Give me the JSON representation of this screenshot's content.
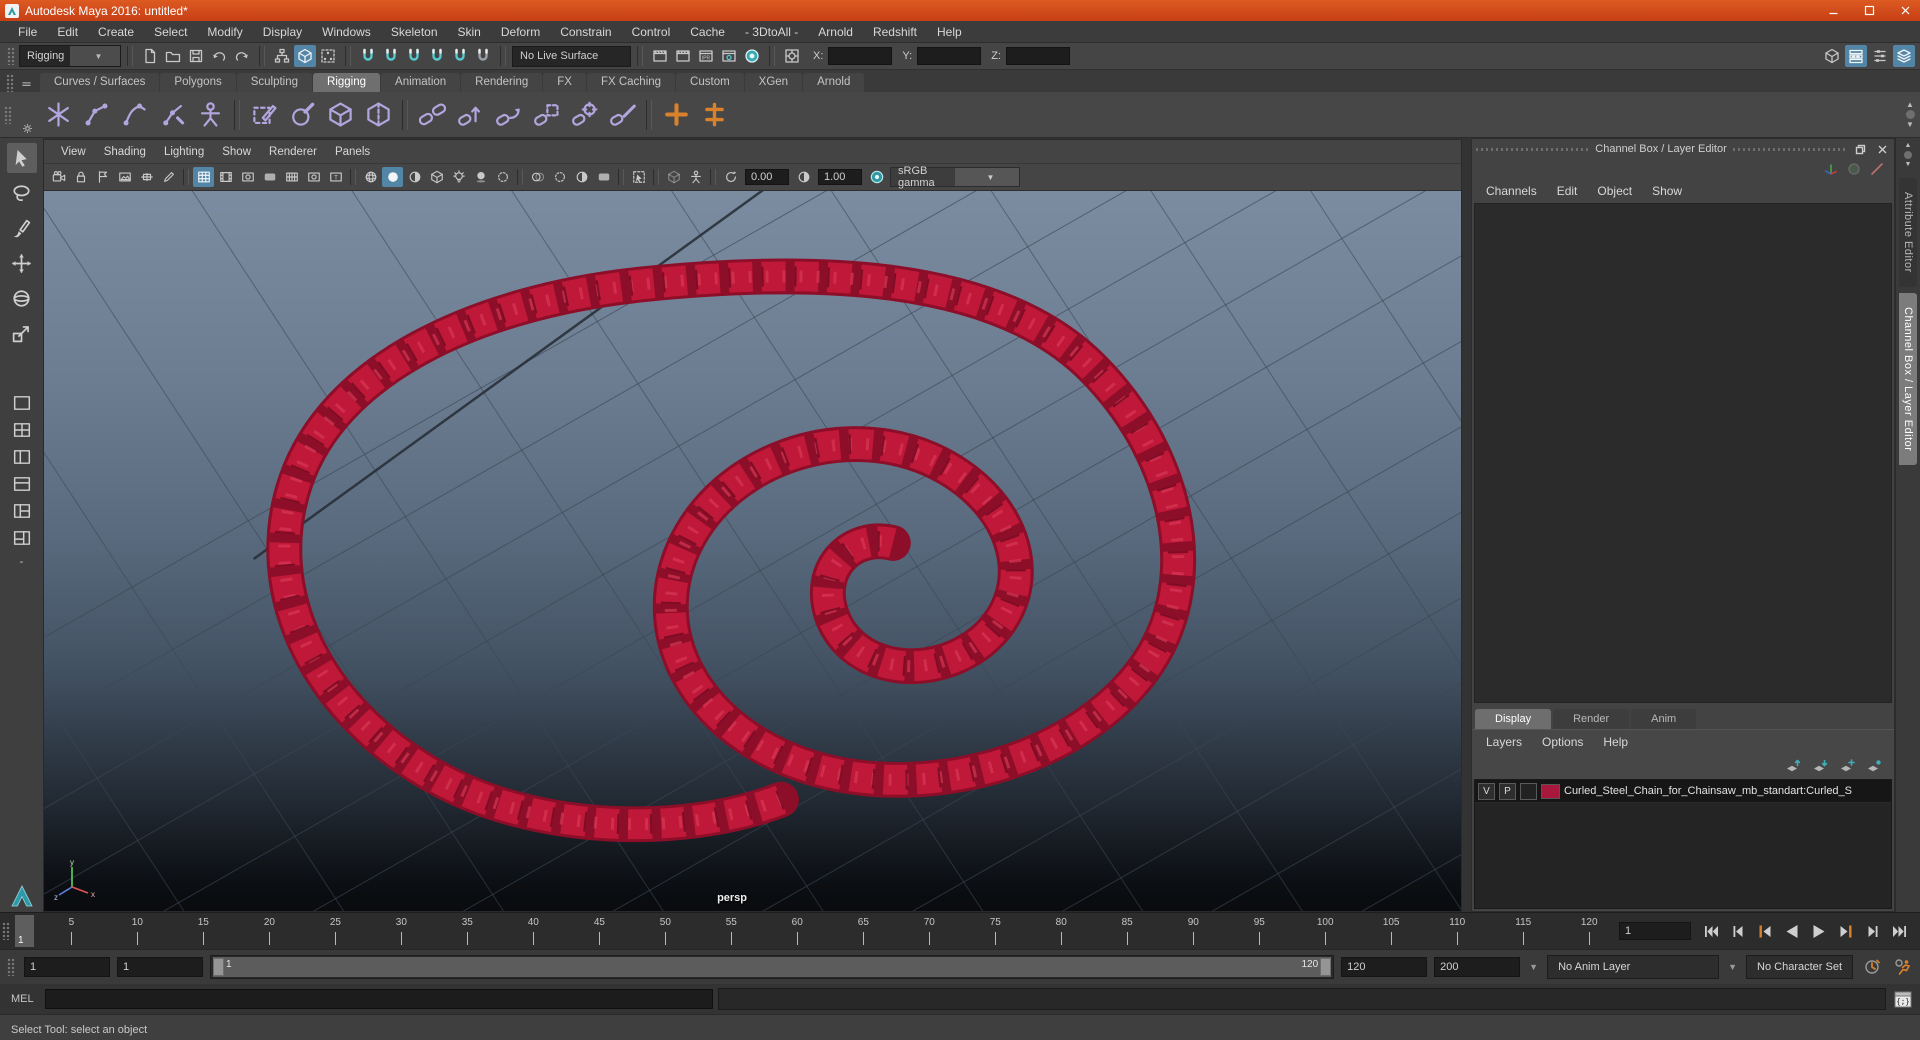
{
  "window": {
    "title": "Autodesk Maya 2016: untitled*"
  },
  "menu_bar": [
    "File",
    "Edit",
    "Create",
    "Select",
    "Modify",
    "Display",
    "Windows",
    "Skeleton",
    "Skin",
    "Deform",
    "Constrain",
    "Control",
    "Cache",
    "- 3DtoAll -",
    "Arnold",
    "Redshift",
    "Help"
  ],
  "status_line": {
    "menu_set": "Rigging",
    "live_surface": "No Live Surface",
    "xyz_labels": {
      "x": "X:",
      "y": "Y:",
      "z": "Z:"
    },
    "groups": {
      "file": [
        {
          "name": "new-scene-icon",
          "glyph": "page"
        },
        {
          "name": "open-scene-icon",
          "glyph": "folder"
        },
        {
          "name": "save-scene-icon",
          "glyph": "save"
        },
        {
          "name": "undo-icon",
          "glyph": "undo"
        },
        {
          "name": "redo-icon",
          "glyph": "redo"
        }
      ],
      "selection": [
        {
          "name": "select-by-hierarchy-icon",
          "glyph": "hier"
        },
        {
          "name": "select-by-object-icon",
          "glyph": "cube",
          "active": true
        },
        {
          "name": "select-by-component-icon",
          "glyph": "comp"
        }
      ],
      "snap": [
        {
          "name": "snap-to-grids-icon",
          "glyph": "magnet",
          "color": "#57c8d0"
        },
        {
          "name": "snap-to-curves-icon",
          "glyph": "magnet",
          "color": "#57c8d0"
        },
        {
          "name": "snap-to-points-icon",
          "glyph": "magnet",
          "color": "#57c8d0"
        },
        {
          "name": "snap-to-projected-center-icon",
          "glyph": "magnet",
          "color": "#57c8d0"
        },
        {
          "name": "snap-to-view-planes-icon",
          "glyph": "magnet",
          "color": "#57c8d0"
        },
        {
          "name": "make-live-icon",
          "glyph": "magnet",
          "color": "#9aa0a6"
        }
      ],
      "render": [
        {
          "name": "render-view-icon",
          "glyph": "slate"
        },
        {
          "name": "render-current-frame-icon",
          "glyph": "slate"
        },
        {
          "name": "ipr-render-icon",
          "glyph": "slateipr"
        },
        {
          "name": "render-settings-icon",
          "glyph": "slategear"
        },
        {
          "name": "paint-effects-icon",
          "glyph": "tealsphere"
        }
      ],
      "panel_toggles": [
        {
          "name": "show-modeling-toolkit-icon",
          "glyph": "cube"
        },
        {
          "name": "show-attribute-editor-icon",
          "glyph": "boxlist",
          "active": true
        },
        {
          "name": "show-tool-settings-icon",
          "glyph": "toolsettings"
        },
        {
          "name": "show-channel-box-icon",
          "glyph": "layers",
          "active": true
        }
      ]
    },
    "xform_icon": {
      "name": "snap-together-icon",
      "glyph": "crosshairsq"
    }
  },
  "shelf": {
    "tabs": [
      "Curves / Surfaces",
      "Polygons",
      "Sculpting",
      "Rigging",
      "Animation",
      "Rendering",
      "FX",
      "FX Caching",
      "Custom",
      "XGen",
      "Arnold"
    ],
    "active_tab": "Rigging",
    "icons": [
      {
        "name": "create-joints-icon",
        "glyph": "asterisk"
      },
      {
        "name": "ik-handle-icon",
        "glyph": "elbow"
      },
      {
        "name": "ik-spline-handle-icon",
        "glyph": "elbow2"
      },
      {
        "name": "insert-joints-icon",
        "glyph": "elbow3"
      },
      {
        "name": "quick-rig-icon",
        "glyph": "person"
      },
      {
        "sep": true
      },
      {
        "name": "edit-membership-icon",
        "glyph": "dashpencil"
      },
      {
        "name": "paint-skin-weights-icon",
        "glyph": "spherebrush"
      },
      {
        "name": "copy-skin-weights-icon",
        "glyph": "cubewire"
      },
      {
        "name": "mirror-skin-weights-icon",
        "glyph": "cubemirror"
      },
      {
        "sep": true
      },
      {
        "name": "smooth-bind-icon",
        "glyph": "link"
      },
      {
        "name": "rigid-bind-icon",
        "glyph": "linkup"
      },
      {
        "name": "detach-skin-icon",
        "glyph": "linkarrow"
      },
      {
        "name": "bind-pose-icon",
        "glyph": "linkdash"
      },
      {
        "name": "interactive-bind-icon",
        "glyph": "linktarget"
      },
      {
        "name": "unbind-skin-icon",
        "glyph": "linkslash"
      },
      {
        "sep": true
      },
      {
        "name": "parent-constraint-icon",
        "glyph": "plus",
        "color": "#d9822b"
      },
      {
        "name": "point-constraint-icon",
        "glyph": "plusline",
        "color": "#d9822b"
      }
    ]
  },
  "toolbox": {
    "tools": [
      {
        "name": "select-tool",
        "glyph": "cursor",
        "active": true
      },
      {
        "name": "lasso-tool",
        "glyph": "lasso"
      },
      {
        "name": "paint-select-tool",
        "glyph": "brush"
      },
      {
        "name": "move-tool",
        "glyph": "movetool"
      },
      {
        "name": "rotate-tool",
        "glyph": "rotatetool"
      },
      {
        "name": "scale-tool",
        "glyph": "scaletool"
      }
    ],
    "layouts": [
      {
        "name": "layout-single-pane",
        "glyph": "layout1"
      },
      {
        "name": "layout-four-pane",
        "glyph": "layout4"
      },
      {
        "name": "layout-two-side",
        "glyph": "layoutL"
      },
      {
        "name": "layout-two-stacked",
        "glyph": "layoutT"
      },
      {
        "name": "layout-outliner-persp",
        "glyph": "layoutO"
      },
      {
        "name": "layout-split-right",
        "glyph": "layoutP"
      }
    ],
    "collapse_label": "-"
  },
  "viewport": {
    "menus": [
      "View",
      "Shading",
      "Lighting",
      "Show",
      "Renderer",
      "Panels"
    ],
    "toolbar": [
      {
        "name": "select-camera-icon",
        "glyph": "camera"
      },
      {
        "name": "lock-camera-icon",
        "glyph": "lock"
      },
      {
        "name": "camera-bookmark-icon",
        "glyph": "flag"
      },
      {
        "name": "image-plane-icon",
        "glyph": "imgplane"
      },
      {
        "name": "2d-pan-zoom-icon",
        "glyph": "pan2d"
      },
      {
        "name": "grease-pencil-icon",
        "glyph": "pencil"
      },
      {
        "sep": true
      },
      {
        "name": "grid-icon",
        "glyph": "grid9",
        "active": true
      },
      {
        "name": "film-gate-icon",
        "glyph": "film"
      },
      {
        "name": "resolution-gate-icon",
        "glyph": "safeaction"
      },
      {
        "name": "gate-mask-icon",
        "glyph": "gatemask"
      },
      {
        "name": "field-chart-icon",
        "glyph": "fieldchart"
      },
      {
        "name": "safe-action-icon",
        "glyph": "safeaction"
      },
      {
        "name": "safe-title-icon",
        "glyph": "safetitle"
      },
      {
        "sep": true
      },
      {
        "name": "wireframe-icon",
        "glyph": "spherewire"
      },
      {
        "name": "smooth-shade-icon",
        "glyph": "sphereshade",
        "active": true
      },
      {
        "name": "bounding-box-icon",
        "glyph": "halfsphere"
      },
      {
        "name": "textured-icon",
        "glyph": "cubewire"
      },
      {
        "name": "use-all-lights-icon",
        "glyph": "bulb"
      },
      {
        "name": "shadows-icon",
        "glyph": "shadowball"
      },
      {
        "name": "ssao-icon",
        "glyph": "dotring"
      },
      {
        "sep": true
      },
      {
        "name": "motion-blur-icon",
        "glyph": "circles2"
      },
      {
        "name": "multisample-icon",
        "glyph": "dotring"
      },
      {
        "name": "depth-of-field-icon",
        "glyph": "contrast"
      },
      {
        "name": "fog-icon",
        "glyph": "gatemask"
      },
      {
        "sep": true
      },
      {
        "name": "isolate-select-icon",
        "glyph": "isolate"
      },
      {
        "sep": true
      },
      {
        "name": "xray-icon",
        "glyph": "xray"
      },
      {
        "name": "xray-joints-icon",
        "glyph": "person"
      }
    ],
    "exposure": "0.00",
    "gamma": "1.00",
    "view_transform": "sRGB gamma",
    "camera_label": "persp"
  },
  "channel_box": {
    "title": "Channel Box / Layer Editor",
    "menus": [
      "Channels",
      "Edit",
      "Object",
      "Show"
    ]
  },
  "layer_editor": {
    "tabs": [
      "Display",
      "Render",
      "Anim"
    ],
    "active_tab": "Display",
    "menus": [
      "Layers",
      "Options",
      "Help"
    ],
    "icons": [
      {
        "name": "move-layer-up-icon",
        "glyph": "layerup"
      },
      {
        "name": "move-layer-down-icon",
        "glyph": "layerdown"
      },
      {
        "name": "create-empty-layer-icon",
        "glyph": "layerplus"
      },
      {
        "name": "create-layer-from-selected-icon",
        "glyph": "layerdot"
      }
    ],
    "layers": [
      {
        "visible": "V",
        "playback": "P",
        "color": "#a8173c",
        "name": "Curled_Steel_Chain_for_Chainsaw_mb_standart:Curled_S"
      }
    ]
  },
  "side_tabs": [
    {
      "label": "Attribute Editor",
      "active": false
    },
    {
      "label": "Channel Box / Layer Editor",
      "active": true
    }
  ],
  "timeline": {
    "current": "1",
    "range_start": 1,
    "range_end": 120,
    "tick_labels": [
      5,
      10,
      15,
      20,
      25,
      30,
      35,
      40,
      45,
      50,
      55,
      60,
      65,
      70,
      75,
      80,
      85,
      90,
      95,
      100,
      105,
      110,
      115,
      120
    ],
    "playback_buttons": [
      {
        "name": "go-to-start-button",
        "glyph": "pbStart"
      },
      {
        "name": "step-back-frame-button",
        "glyph": "pbPrevF"
      },
      {
        "name": "step-back-key-button",
        "glyph": "pbPrevK"
      },
      {
        "name": "play-backwards-button",
        "glyph": "pbPlayB"
      },
      {
        "name": "play-forwards-button",
        "glyph": "pbPlayF"
      },
      {
        "name": "step-forward-key-button",
        "glyph": "pbNextK"
      },
      {
        "name": "step-forward-frame-button",
        "glyph": "pbNextF"
      },
      {
        "name": "go-to-end-button",
        "glyph": "pbEnd"
      }
    ]
  },
  "range_slider": {
    "anim_start": "1",
    "playback_start": "1",
    "bar_start_label": "1",
    "bar_end_label": "120",
    "playback_end": "120",
    "anim_end": "200",
    "anim_layer": "No Anim Layer",
    "character_set": "No Character Set"
  },
  "command_line": {
    "label": "MEL"
  },
  "help_line": {
    "text": "Select Tool: select an object"
  },
  "colors": {
    "titlebar": "#cf4a1e",
    "selection_blue": "#5285a6",
    "teal": "#3fb0ba",
    "shelf_purple": "#b3a5dd",
    "orange": "#d9822b",
    "chain_red": "#bf1838",
    "layer_swatch": "#a8173c"
  }
}
